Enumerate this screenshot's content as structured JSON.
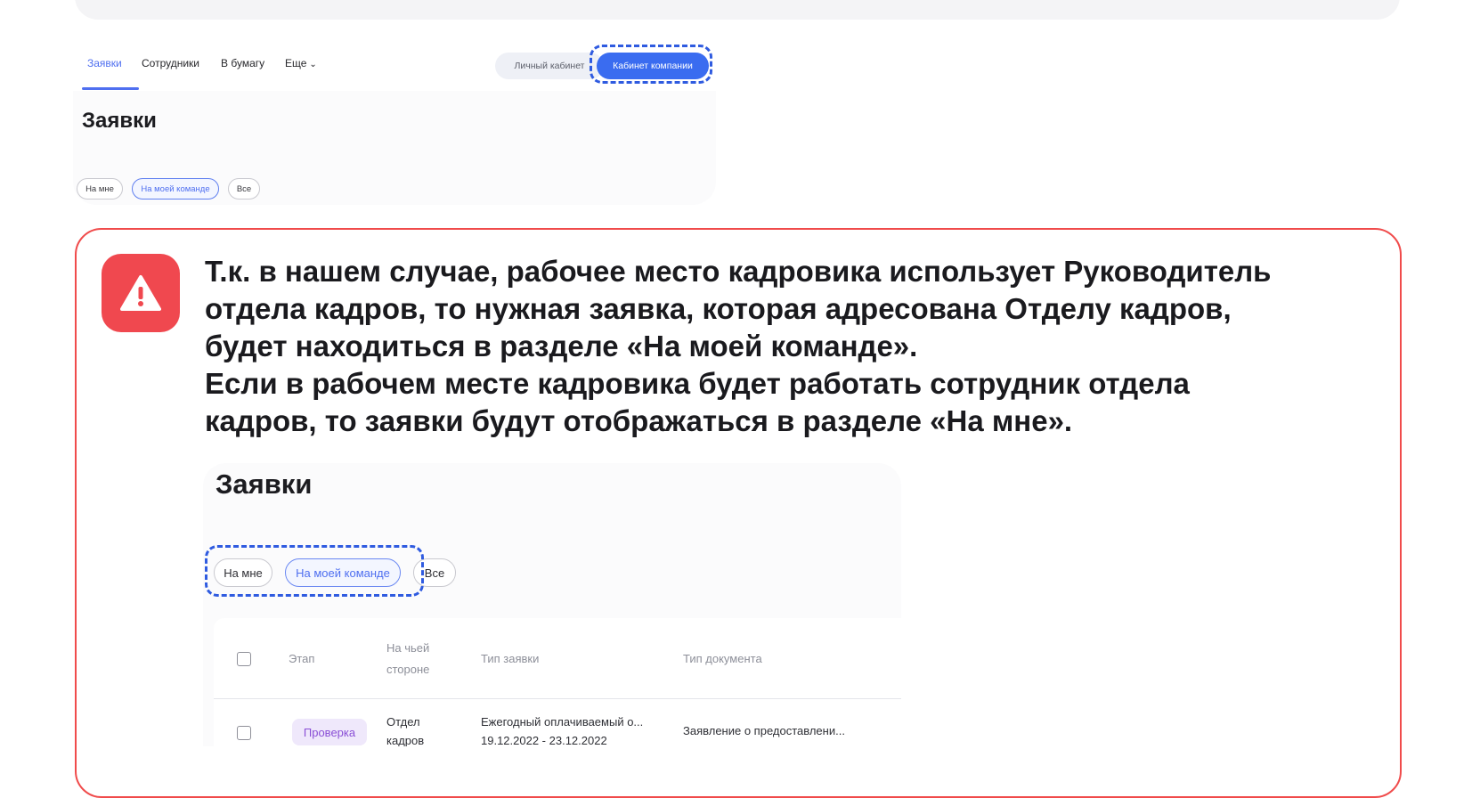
{
  "nav": {
    "tabs": [
      "Заявки",
      "Сотрудники",
      "В бумагу"
    ],
    "more_label": "Еще",
    "personal_cabinet": "Личный кабинет",
    "company_cabinet": "Кабинет компании"
  },
  "screenshot_top": {
    "title": "Заявки",
    "filters": [
      "На мне",
      "На моей команде",
      "Все"
    ],
    "selected_filter": "На моей команде"
  },
  "alert": {
    "icon": "warning-triangle-icon",
    "color": "#f0484f",
    "lines": [
      "Т.к. в нашем случае, рабочее место кадровика использует Руководитель",
      "отдела кадров, то нужная заявка, которая адресована Отделу кадров,",
      "будет находиться в разделе «На моей команде».",
      "Если в рабочем месте кадровика будет работать сотрудник отдела",
      "кадров, то заявки будут отображаться в разделе «На мне»."
    ]
  },
  "screenshot_bottom": {
    "title": "Заявки",
    "filters": [
      "На мне",
      "На моей команде",
      "Все"
    ],
    "selected_filter": "На моей команде",
    "table": {
      "headers": {
        "stage": "Этап",
        "side_line1": "На чьей",
        "side_line2": "стороне",
        "request_type": "Тип заявки",
        "document_type": "Тип документа"
      },
      "row": {
        "stage": "Проверка",
        "side_line1": "Отдел",
        "side_line2": "кадров",
        "request_type": "Ежегодный оплачиваемый о...",
        "dates": "19.12.2022 - 23.12.2022",
        "document_type": "Заявление о предоставлени..."
      }
    }
  },
  "colors": {
    "accent": "#3a6cf0",
    "dashed_highlight": "#2f5be0",
    "alert_border": "#f04b4b",
    "stage_badge_bg": "#efe8fb",
    "stage_badge_text": "#8a4fd6"
  }
}
